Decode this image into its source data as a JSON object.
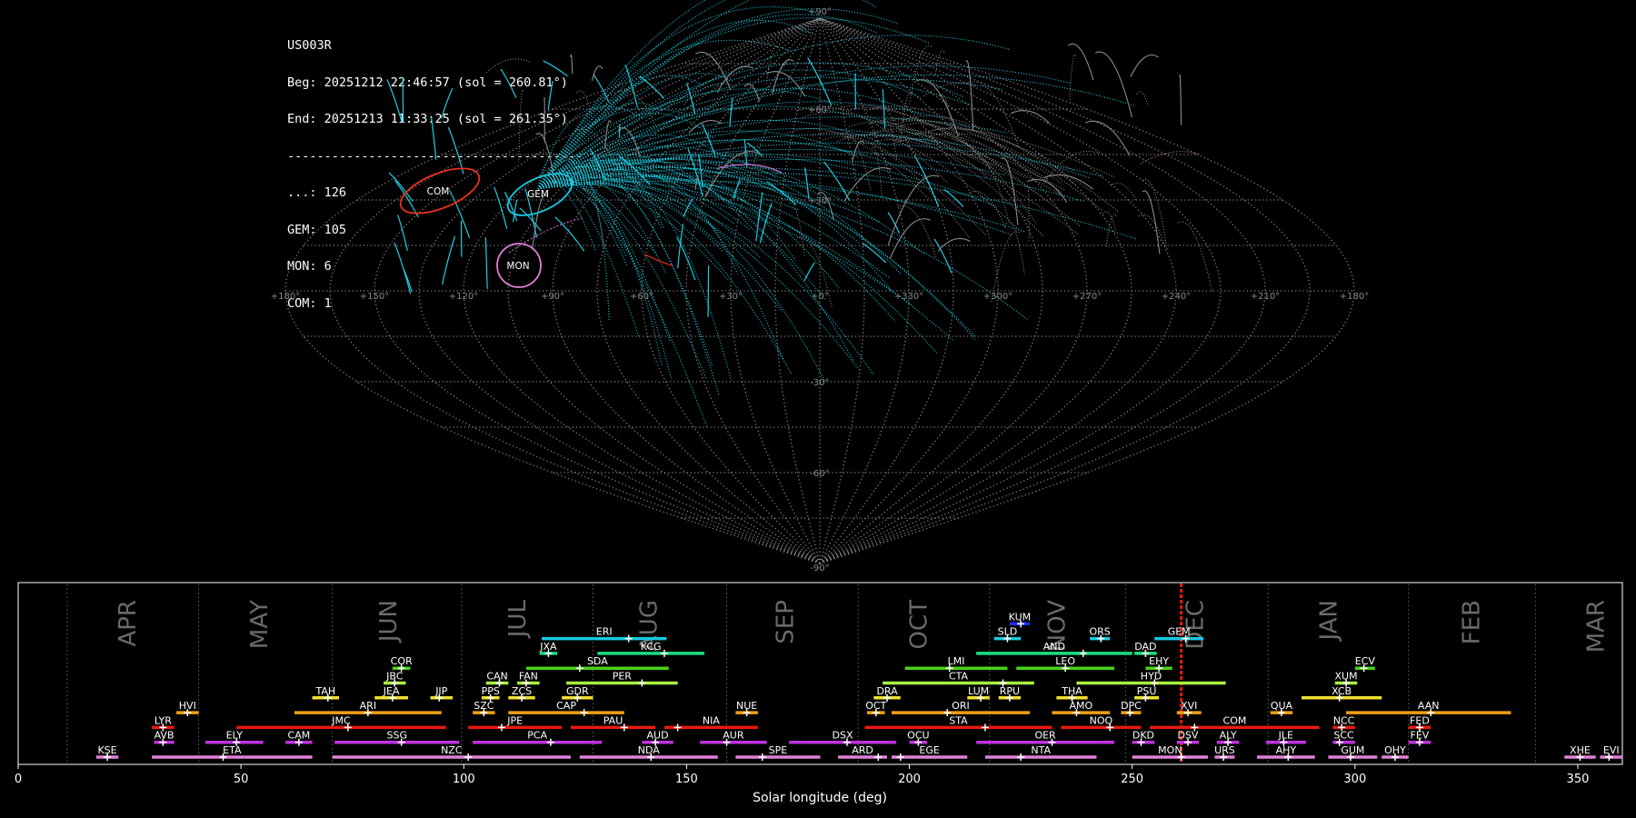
{
  "info": {
    "station": "US003R",
    "beg": "Beg: 20251212 22:46:57 (sol = 260.81°)",
    "end": "End: 20251213 11:33:25 (sol = 261.35°)",
    "separator": "----------------------------------------",
    "counts": [
      "...: 126",
      "GEM: 105",
      "MON: 6",
      "COM: 1"
    ]
  },
  "sky_map": {
    "lat_labels": [
      "+90°",
      "+60°",
      "+30°",
      "-30°",
      "-60°",
      "-90°"
    ],
    "lon_labels": [
      "+180°",
      "+150°",
      "+120°",
      "+90°",
      "+60°",
      "+30°",
      "+0°",
      "+330°",
      "+300°",
      "+270°",
      "+240°",
      "+210°",
      "+180°"
    ],
    "radiants": [
      {
        "name": "COM",
        "color": "#e8301c"
      },
      {
        "name": "GEM",
        "color": "#18c8e0"
      },
      {
        "name": "MON",
        "color": "#e080d8"
      }
    ],
    "meteor_colors": {
      "gem": "#18d0e6",
      "sporadic": "#8a8a8a",
      "mon": "#d070d0",
      "com": "#d02810"
    }
  },
  "chart_data": {
    "type": "timeline",
    "xlabel": "Solar longitude (deg)",
    "xlim": [
      0,
      360
    ],
    "x_ticks": [
      0,
      50,
      100,
      150,
      200,
      250,
      300,
      350
    ],
    "months": [
      {
        "name": "APR",
        "sol": 24.5
      },
      {
        "name": "MAY",
        "sol": 54
      },
      {
        "name": "JUN",
        "sol": 83
      },
      {
        "name": "JUL",
        "sol": 112
      },
      {
        "name": "AUG",
        "sol": 141.5
      },
      {
        "name": "SEP",
        "sol": 172
      },
      {
        "name": "OCT",
        "sol": 202
      },
      {
        "name": "NOV",
        "sol": 233
      },
      {
        "name": "DEC",
        "sol": 264
      },
      {
        "name": "JAN",
        "sol": 294
      },
      {
        "name": "FEB",
        "sol": 326
      },
      {
        "name": "MAR",
        "sol": 354
      }
    ],
    "month_boundaries": [
      11,
      40.5,
      70.5,
      99.5,
      129,
      159,
      188.5,
      218,
      248.5,
      280.5,
      312,
      340.5
    ],
    "current_sol": 261,
    "showers": [
      {
        "code": "KUM",
        "start": 222.5,
        "end": 227,
        "peak": 225,
        "row": 9,
        "color": "#1a2cff"
      },
      {
        "code": "ERI",
        "start": 117.5,
        "end": 145.5,
        "peak": 137,
        "row": 8,
        "color": "#18c8e0"
      },
      {
        "code": "SLD",
        "start": 219,
        "end": 225,
        "peak": 222,
        "row": 8,
        "color": "#18c8e0"
      },
      {
        "code": "ORS",
        "start": 240.5,
        "end": 245,
        "peak": 243,
        "row": 8,
        "color": "#18c8e0"
      },
      {
        "code": "GEM",
        "start": 255,
        "end": 266,
        "peak": 262,
        "row": 8,
        "color": "#18c8e0"
      },
      {
        "code": "JXA",
        "start": 117,
        "end": 121,
        "peak": 119,
        "row": 7,
        "color": "#18e080"
      },
      {
        "code": "KCG",
        "start": 130,
        "end": 154,
        "peak": 145,
        "row": 7,
        "color": "#18e080"
      },
      {
        "code": "AND",
        "start": 215,
        "end": 250,
        "peak": 239,
        "row": 7,
        "color": "#18e080"
      },
      {
        "code": "DAD",
        "start": 250.5,
        "end": 255.5,
        "peak": 253,
        "row": 7,
        "color": "#18e080"
      },
      {
        "code": "COR",
        "start": 84,
        "end": 88,
        "peak": 86,
        "row": 6,
        "color": "#4ad21a"
      },
      {
        "code": "SDA",
        "start": 114,
        "end": 146,
        "peak": 126,
        "row": 6,
        "color": "#4ad21a"
      },
      {
        "code": "LMI",
        "start": 199,
        "end": 222,
        "peak": 209,
        "row": 6,
        "color": "#4ad21a"
      },
      {
        "code": "LEO",
        "start": 224,
        "end": 246,
        "peak": 235,
        "row": 6,
        "color": "#4ad21a"
      },
      {
        "code": "EHY",
        "start": 253,
        "end": 259,
        "peak": 256,
        "row": 6,
        "color": "#4ad21a"
      },
      {
        "code": "ECV",
        "start": 300,
        "end": 304.5,
        "peak": 302,
        "row": 6,
        "color": "#4ad21a"
      },
      {
        "code": "JBC",
        "start": 82,
        "end": 87,
        "peak": 84.5,
        "row": 5,
        "color": "#a8f040"
      },
      {
        "code": "CAN",
        "start": 105,
        "end": 110,
        "peak": 108,
        "row": 5,
        "color": "#a8f040"
      },
      {
        "code": "FAN",
        "start": 112,
        "end": 117,
        "peak": 114,
        "row": 5,
        "color": "#a8f040"
      },
      {
        "code": "PER",
        "start": 123,
        "end": 148,
        "peak": 140,
        "row": 5,
        "color": "#a8f040"
      },
      {
        "code": "CTA",
        "start": 194,
        "end": 228,
        "peak": 221,
        "row": 5,
        "color": "#a8f040"
      },
      {
        "code": "HYD",
        "start": 237.5,
        "end": 271,
        "peak": 255,
        "row": 5,
        "color": "#a8f040"
      },
      {
        "code": "XUM",
        "start": 295.5,
        "end": 300.5,
        "peak": 298,
        "row": 5,
        "color": "#a8f040"
      },
      {
        "code": "TAH",
        "start": 66,
        "end": 72,
        "peak": 69.5,
        "row": 4,
        "color": "#f0e030"
      },
      {
        "code": "JEA",
        "start": 80,
        "end": 87.5,
        "peak": 84,
        "row": 4,
        "color": "#f0e030"
      },
      {
        "code": "JIP",
        "start": 92.5,
        "end": 97.5,
        "peak": 94.5,
        "row": 4,
        "color": "#f0e030"
      },
      {
        "code": "PPS",
        "start": 104,
        "end": 108,
        "peak": 106,
        "row": 4,
        "color": "#f0e030"
      },
      {
        "code": "ZCS",
        "start": 110,
        "end": 116,
        "peak": 113,
        "row": 4,
        "color": "#f0e030"
      },
      {
        "code": "GDR",
        "start": 122,
        "end": 129,
        "peak": 125.5,
        "row": 4,
        "color": "#f0e030"
      },
      {
        "code": "DRA",
        "start": 192,
        "end": 198,
        "peak": 195,
        "row": 4,
        "color": "#f0e030"
      },
      {
        "code": "LUM",
        "start": 213,
        "end": 218,
        "peak": 216,
        "row": 4,
        "color": "#f0e030"
      },
      {
        "code": "RPU",
        "start": 220,
        "end": 225,
        "peak": 222.5,
        "row": 4,
        "color": "#f0e030"
      },
      {
        "code": "THA",
        "start": 233,
        "end": 240,
        "peak": 236.5,
        "row": 4,
        "color": "#f0e030"
      },
      {
        "code": "PSU",
        "start": 250.5,
        "end": 256,
        "peak": 253,
        "row": 4,
        "color": "#f0e030"
      },
      {
        "code": "XCB",
        "start": 288,
        "end": 306,
        "peak": 296.5,
        "row": 4,
        "color": "#f0e030"
      },
      {
        "code": "HVI",
        "start": 35.5,
        "end": 40.5,
        "peak": 38,
        "row": 3,
        "color": "#f0a010"
      },
      {
        "code": "ARI",
        "start": 62,
        "end": 95,
        "peak": 78.5,
        "row": 3,
        "color": "#f0a010"
      },
      {
        "code": "SZC",
        "start": 102,
        "end": 107,
        "peak": 104.5,
        "row": 3,
        "color": "#f0a010"
      },
      {
        "code": "CAP",
        "start": 110,
        "end": 136,
        "peak": 127,
        "row": 3,
        "color": "#f0a010"
      },
      {
        "code": "NUE",
        "start": 161,
        "end": 166,
        "peak": 163.5,
        "row": 3,
        "color": "#f0a010"
      },
      {
        "code": "OCT",
        "start": 190.5,
        "end": 194.5,
        "peak": 192.5,
        "row": 3,
        "color": "#f0a010"
      },
      {
        "code": "ORI",
        "start": 196,
        "end": 227,
        "peak": 208.5,
        "row": 3,
        "color": "#f0a010"
      },
      {
        "code": "AMO",
        "start": 232,
        "end": 245,
        "peak": 237.5,
        "row": 3,
        "color": "#f0a010"
      },
      {
        "code": "DPC",
        "start": 247.5,
        "end": 252,
        "peak": 249.5,
        "row": 3,
        "color": "#f0a010"
      },
      {
        "code": "XVI",
        "start": 260,
        "end": 265.5,
        "peak": 262.5,
        "row": 3,
        "color": "#f0a010"
      },
      {
        "code": "QUA",
        "start": 281,
        "end": 286,
        "peak": 283.5,
        "row": 3,
        "color": "#f0a010"
      },
      {
        "code": "AAN",
        "start": 298,
        "end": 335,
        "peak": 317,
        "row": 3,
        "color": "#f0a010"
      },
      {
        "code": "LYR",
        "start": 30,
        "end": 35,
        "peak": 32.5,
        "row": 2,
        "color": "#e81a10"
      },
      {
        "code": "JMC",
        "start": 49,
        "end": 96,
        "peak": 74,
        "row": 2,
        "color": "#e81a10"
      },
      {
        "code": "JPE",
        "start": 101,
        "end": 122,
        "peak": 108.5,
        "row": 2,
        "color": "#e81a10"
      },
      {
        "code": "PAU",
        "start": 124,
        "end": 143,
        "peak": 136,
        "row": 2,
        "color": "#e81a10"
      },
      {
        "code": "NIA",
        "start": 145,
        "end": 166,
        "peak": 148,
        "row": 2,
        "color": "#e81a10"
      },
      {
        "code": "STA",
        "start": 190,
        "end": 232,
        "peak": 217,
        "row": 2,
        "color": "#e81a10"
      },
      {
        "code": "NOO",
        "start": 234,
        "end": 252,
        "peak": 245,
        "row": 2,
        "color": "#e81a10"
      },
      {
        "code": "COM",
        "start": 254,
        "end": 292,
        "peak": 264,
        "row": 2,
        "color": "#e81a10"
      },
      {
        "code": "NCC",
        "start": 295,
        "end": 300,
        "peak": 297,
        "row": 2,
        "color": "#e81a10"
      },
      {
        "code": "FED",
        "start": 312,
        "end": 317,
        "peak": 314.5,
        "row": 2,
        "color": "#e81a10"
      },
      {
        "code": "AVB",
        "start": 30.5,
        "end": 35,
        "peak": 32.5,
        "row": 1,
        "color": "#c030e0"
      },
      {
        "code": "ELY",
        "start": 42,
        "end": 55,
        "peak": 49,
        "row": 1,
        "color": "#c030e0"
      },
      {
        "code": "CAM",
        "start": 60,
        "end": 66,
        "peak": 63,
        "row": 1,
        "color": "#c030e0"
      },
      {
        "code": "SSG",
        "start": 71,
        "end": 99,
        "peak": 86,
        "row": 1,
        "color": "#c030e0"
      },
      {
        "code": "PCA",
        "start": 102,
        "end": 131,
        "peak": 119.5,
        "row": 1,
        "color": "#c030e0"
      },
      {
        "code": "AUD",
        "start": 140,
        "end": 147,
        "peak": 143,
        "row": 1,
        "color": "#c030e0"
      },
      {
        "code": "AUR",
        "start": 153,
        "end": 168,
        "peak": 159,
        "row": 1,
        "color": "#c030e0"
      },
      {
        "code": "DSX",
        "start": 173,
        "end": 197,
        "peak": 186,
        "row": 1,
        "color": "#c030e0"
      },
      {
        "code": "OCU",
        "start": 200,
        "end": 204,
        "peak": 202,
        "row": 1,
        "color": "#c030e0"
      },
      {
        "code": "OER",
        "start": 215,
        "end": 246,
        "peak": 232,
        "row": 1,
        "color": "#c030e0"
      },
      {
        "code": "DKD",
        "start": 250,
        "end": 255,
        "peak": 252,
        "row": 1,
        "color": "#c030e0"
      },
      {
        "code": "DSV",
        "start": 260,
        "end": 265,
        "peak": 262.5,
        "row": 1,
        "color": "#c030e0"
      },
      {
        "code": "ALY",
        "start": 269,
        "end": 274,
        "peak": 271.5,
        "row": 1,
        "color": "#c030e0"
      },
      {
        "code": "JLE",
        "start": 280,
        "end": 289,
        "peak": 284,
        "row": 1,
        "color": "#c030e0"
      },
      {
        "code": "SCC",
        "start": 295,
        "end": 300,
        "peak": 296.5,
        "row": 1,
        "color": "#c030e0"
      },
      {
        "code": "FEV",
        "start": 312,
        "end": 317,
        "peak": 314.5,
        "row": 1,
        "color": "#c030e0"
      },
      {
        "code": "KSE",
        "start": 17.5,
        "end": 22.5,
        "peak": 20,
        "row": 0,
        "color": "#e080d8"
      },
      {
        "code": "ETA",
        "start": 30,
        "end": 66,
        "peak": 46,
        "row": 0,
        "color": "#e080d8"
      },
      {
        "code": "NZC",
        "start": 70.5,
        "end": 124,
        "peak": 101,
        "row": 0,
        "color": "#e080d8"
      },
      {
        "code": "NDA",
        "start": 126,
        "end": 157,
        "peak": 142,
        "row": 0,
        "color": "#e080d8"
      },
      {
        "code": "SPE",
        "start": 161,
        "end": 180,
        "peak": 167,
        "row": 0,
        "color": "#e080d8"
      },
      {
        "code": "ARD",
        "start": 184,
        "end": 195,
        "peak": 193,
        "row": 0,
        "color": "#e080d8"
      },
      {
        "code": "EGE",
        "start": 196,
        "end": 213,
        "peak": 198,
        "row": 0,
        "color": "#e080d8"
      },
      {
        "code": "NTA",
        "start": 217,
        "end": 242,
        "peak": 225,
        "row": 0,
        "color": "#e080d8"
      },
      {
        "code": "MON",
        "start": 250,
        "end": 267,
        "peak": 261,
        "row": 0,
        "color": "#e080d8"
      },
      {
        "code": "URS",
        "start": 268.5,
        "end": 273,
        "peak": 270.5,
        "row": 0,
        "color": "#e080d8"
      },
      {
        "code": "AHY",
        "start": 278,
        "end": 291,
        "peak": 285,
        "row": 0,
        "color": "#e080d8"
      },
      {
        "code": "GUM",
        "start": 294,
        "end": 305,
        "peak": 299,
        "row": 0,
        "color": "#e080d8"
      },
      {
        "code": "OHY",
        "start": 306,
        "end": 312,
        "peak": 309,
        "row": 0,
        "color": "#e080d8"
      },
      {
        "code": "XHE",
        "start": 347,
        "end": 354,
        "peak": 350.5,
        "row": 0,
        "color": "#e080d8"
      },
      {
        "code": "EVI",
        "start": 355,
        "end": 360,
        "peak": 357,
        "row": 0,
        "color": "#e080d8"
      }
    ]
  }
}
